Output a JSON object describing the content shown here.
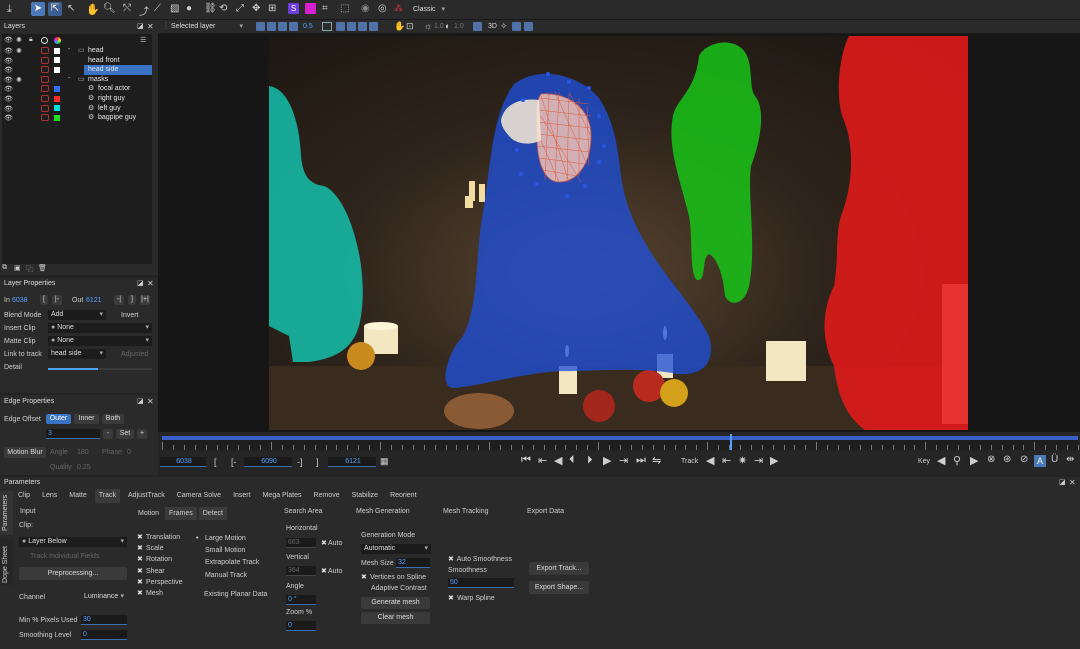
{
  "toolbar": {
    "workspace": "Classic",
    "layer_scope": "Selected layer",
    "opacity_value": "0.5",
    "value_a": "1.0",
    "value_b": "1.0"
  },
  "layers_panel": {
    "title": "Layers",
    "items": [
      {
        "name": "head",
        "is_group": true,
        "color": "#ffffff",
        "indent": 0,
        "selected": false
      },
      {
        "name": "head front",
        "is_group": false,
        "color": "#ffffff",
        "indent": 1,
        "selected": false
      },
      {
        "name": "head side",
        "is_group": false,
        "color": "#ffffff",
        "indent": 1,
        "selected": true
      },
      {
        "name": "masks",
        "is_group": true,
        "color": "",
        "indent": 0,
        "selected": false
      },
      {
        "name": "focal actor",
        "is_group": false,
        "color": "#2f6cff",
        "indent": 1,
        "selected": false
      },
      {
        "name": "right guy",
        "is_group": false,
        "color": "#ff2b2b",
        "indent": 1,
        "selected": false
      },
      {
        "name": "left guy",
        "is_group": false,
        "color": "#00e0e0",
        "indent": 1,
        "selected": false
      },
      {
        "name": "bagpipe guy",
        "is_group": false,
        "color": "#19e019",
        "indent": 1,
        "selected": false
      }
    ]
  },
  "layer_properties": {
    "title": "Layer Properties",
    "in_label": "In",
    "in_value": "6038",
    "out_label": "Out",
    "out_value": "6121",
    "blend_mode_label": "Blend Mode",
    "blend_mode_value": "Add",
    "invert_label": "Invert",
    "insert_clip_label": "Insert Clip",
    "insert_clip_value": "None",
    "matte_clip_label": "Matte Clip",
    "matte_clip_value": "None",
    "link_to_track_label": "Link to track",
    "link_to_track_value": "head side",
    "adjusted_label": "Adjusted",
    "detail_label": "Detail"
  },
  "edge_properties": {
    "title": "Edge Properties",
    "edge_offset_label": "Edge Offset",
    "tabs": [
      "Outer",
      "Inner",
      "Both"
    ],
    "active_tab": 0,
    "offset_value": "3",
    "minus_label": "-",
    "set_label": "Set",
    "plus_label": "+",
    "motion_blur_label": "Motion Blur",
    "angle_label": "Angle",
    "angle_value": "180",
    "phase_label": "Phase",
    "phase_value": "0",
    "quality_label": "Quality",
    "quality_value": "0.25"
  },
  "timeline": {
    "start_frame": "6038",
    "current_frame": "6090",
    "end_frame": "6121",
    "in_bracket": "[",
    "in_dash": "[-",
    "out_dash": "-]",
    "out_bracket": "]",
    "track_label": "Track",
    "key_label": "Key",
    "playhead_fraction": 0.62
  },
  "parameters": {
    "title": "Parameters",
    "side_tabs": [
      "Parameters",
      "Dope Sheet"
    ],
    "tabs": [
      "Clip",
      "Lens",
      "Matte",
      "Track",
      "AdjustTrack",
      "Camera Solve",
      "Insert",
      "Mega Plates",
      "Remove",
      "Stabilize",
      "Reorient"
    ],
    "active_tab": 3,
    "input": {
      "title": "Input",
      "clip_label": "Clip:",
      "clip_value": "Layer Below",
      "track_individual_fields": "Track Individual Fields",
      "preprocessing_label": "Preprocessing...",
      "channel_label": "Channel",
      "channel_value": "Luminance",
      "min_pixels_label": "Min % Pixels Used",
      "min_pixels_value": "30",
      "smoothing_label": "Smoothing Level",
      "smoothing_value": "0"
    },
    "motion": {
      "tabs": [
        "Motion",
        "Frames",
        "Detect"
      ],
      "active_tab": 0,
      "options": [
        {
          "label": "Translation",
          "checked": true
        },
        {
          "label": "Scale",
          "checked": true
        },
        {
          "label": "Rotation",
          "checked": true
        },
        {
          "label": "Shear",
          "checked": true
        },
        {
          "label": "Perspective",
          "checked": true
        },
        {
          "label": "Mesh",
          "checked": true
        }
      ],
      "modes": [
        {
          "label": "Large Motion",
          "selected": true
        },
        {
          "label": "Small Motion",
          "selected": false
        },
        {
          "label": "Extrapolate Track",
          "selected": false
        },
        {
          "label": "Manual Track",
          "selected": false
        }
      ],
      "existing_planar": "Existing Planar Data"
    },
    "search_area": {
      "title": "Search Area",
      "horizontal_label": "Horizontal",
      "horizontal_value": "663",
      "vertical_label": "Vertical",
      "vertical_value": "364",
      "auto_label": "Auto",
      "angle_label": "Angle",
      "angle_value": "0 °",
      "zoom_label": "Zoom %",
      "zoom_value": "0"
    },
    "mesh_generation": {
      "title": "Mesh Generation",
      "mode_label": "Generation Mode",
      "mode_value": "Automatic",
      "mesh_size_label": "Mesh Size",
      "mesh_size_value": "32",
      "vertices_on_spline": "Vertices on Spline",
      "adaptive_contrast": "Adaptive Contrast",
      "generate_label": "Generate mesh",
      "clear_label": "Clear mesh"
    },
    "mesh_tracking": {
      "title": "Mesh Tracking",
      "auto_smoothness": "Auto Smoothness",
      "smoothness_label": "Smoothness",
      "smoothness_value": "50",
      "warp_spline": "Warp Spline"
    },
    "export_data": {
      "title": "Export Data",
      "export_track": "Export Track...",
      "export_shape": "Export Shape..."
    }
  },
  "colors": {
    "accent": "#4fa3ff",
    "selection": "#3a72c4",
    "mask_blue": "#1f4fd8",
    "mask_red": "#e41a1a",
    "mask_green": "#18c418",
    "mask_cyan": "#11d6c0"
  }
}
